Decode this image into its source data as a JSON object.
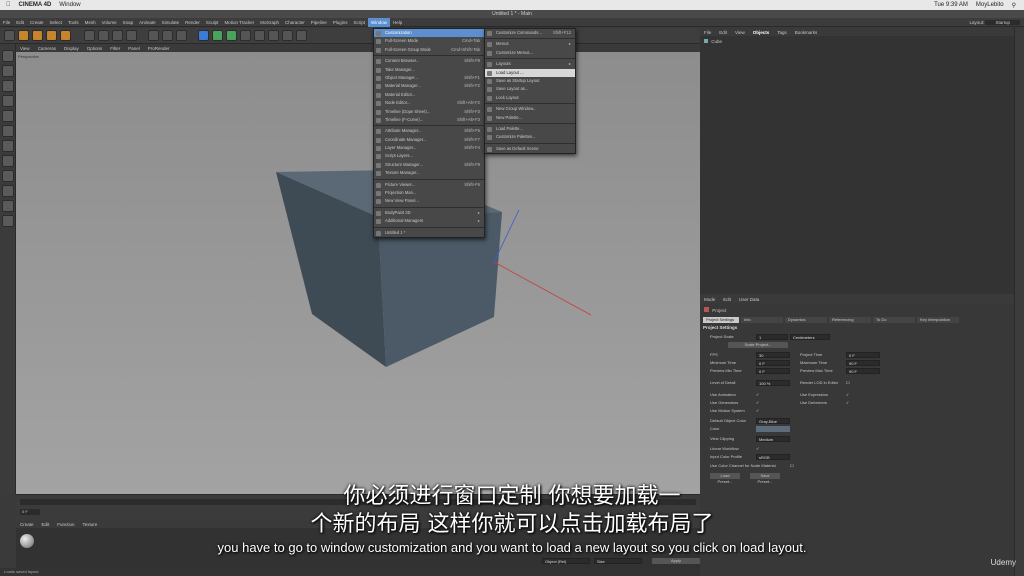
{
  "macbar": {
    "app": "CINEMA 4D",
    "menu": "Window",
    "time": "Tue 9:39 AM",
    "user": "MoyLebito"
  },
  "window_title": "Untitled 1 * - Main",
  "menubar": [
    "File",
    "Edit",
    "Create",
    "Select",
    "Tools",
    "Mesh",
    "Volume",
    "Snap",
    "Animate",
    "Simulate",
    "Render",
    "Sculpt",
    "Motion Tracker",
    "MoGraph",
    "Character",
    "Pipeline",
    "Plugins",
    "Script",
    "Window",
    "Help"
  ],
  "menubar_active": "Window",
  "layout": {
    "label": "Layout:",
    "value": "Startup"
  },
  "viewport_menu": [
    "View",
    "Cameras",
    "Display",
    "Options",
    "Filter",
    "Panel",
    "ProRender"
  ],
  "viewport_label": "Perspective",
  "material_menu": [
    "Create",
    "Edit",
    "Function",
    "Texture"
  ],
  "statusbar": "Loads saved layout",
  "object_menu": [
    "File",
    "Edit",
    "View",
    "Objects",
    "Tags",
    "Bookmarks"
  ],
  "object_menu_active": "Objects",
  "object_item": "Cube",
  "attr_menu": [
    "Mode",
    "Edit",
    "User Data"
  ],
  "attr_header": "Project",
  "attr_tabs": [
    "Project Settings",
    "Info",
    "Dynamics",
    "Referencing",
    "To Do",
    "Key Interpolation"
  ],
  "attr_section": "Project Settings",
  "attrs": {
    "project_scale": "Project Scale",
    "project_scale_val": "1",
    "project_scale_unit": "Centimeters",
    "scale_project": "Scale Project...",
    "fps": "FPS",
    "fps_val": "30",
    "project_time": "Project Time",
    "project_time_val": "0 F",
    "min_time": "Minimum Time",
    "min_time_val": "0 F",
    "max_time": "Maximum Time",
    "max_time_val": "90 F",
    "prev_min": "Preview Min Time",
    "prev_min_val": "0 F",
    "prev_max": "Preview Max Time",
    "prev_max_val": "90 F",
    "lod": "Level of Detail",
    "lod_val": "100 %",
    "render_lod": "Render LOD in Editor",
    "use_anim": "Use Animation",
    "use_expr": "Use Expression",
    "use_gen": "Use Generators",
    "use_def": "Use Deformers",
    "use_motion": "Use Motion System",
    "def_obj_color": "Default Object Color",
    "def_obj_color_val": "Gray-Blue",
    "color": "Color",
    "view_clipping": "View Clipping",
    "view_clipping_val": "Medium",
    "linear_wf": "Linear Workflow",
    "input_color": "Input Color Profile",
    "input_color_val": "sRGB",
    "use_color_channel": "Use Color Channel for Node Material",
    "load_preset": "Load Preset...",
    "save_preset": "Save Preset..."
  },
  "bottom_fields": {
    "object_rel": "Object (Rel)",
    "size": "Size",
    "apply": "Apply"
  },
  "window_menu": [
    {
      "label": "Customization",
      "shortcut": "",
      "hl": true
    },
    {
      "label": "Full-Screen Mode",
      "shortcut": "Cmd+Tab"
    },
    {
      "label": "Full-Screen Group Mode",
      "shortcut": "Cmd+Shift+Tab"
    },
    {
      "sep": true
    },
    {
      "label": "Content Browser...",
      "shortcut": "Shift+F8"
    },
    {
      "label": "Take Manager...",
      "shortcut": ""
    },
    {
      "label": "Object Manager...",
      "shortcut": "Shift+F1"
    },
    {
      "label": "Material Manager...",
      "shortcut": "Shift+F2"
    },
    {
      "label": "Material Editor...",
      "shortcut": ""
    },
    {
      "label": "Node Editor...",
      "shortcut": "Shift+Alt+F2"
    },
    {
      "label": "Timeline (Dope Sheet)...",
      "shortcut": "Shift+F3"
    },
    {
      "label": "Timeline (F-Curve)...",
      "shortcut": "Shift+Alt+F3"
    },
    {
      "sep": true
    },
    {
      "label": "Attribute Manager...",
      "shortcut": "Shift+F5"
    },
    {
      "label": "Coordinate Manager...",
      "shortcut": "Shift+F7"
    },
    {
      "label": "Layer Manager...",
      "shortcut": "Shift+F4"
    },
    {
      "label": "Script Layers...",
      "shortcut": ""
    },
    {
      "label": "Structure Manager...",
      "shortcut": "Shift+F9"
    },
    {
      "label": "Texture Manager...",
      "shortcut": ""
    },
    {
      "sep": true
    },
    {
      "label": "Picture Viewer...",
      "shortcut": "Shift+F6"
    },
    {
      "label": "Projection Man...",
      "shortcut": ""
    },
    {
      "label": "New View Panel...",
      "shortcut": ""
    },
    {
      "sep": true
    },
    {
      "label": "BodyPaint 3D",
      "shortcut": "▸"
    },
    {
      "label": "Additional Managers",
      "shortcut": "▸"
    },
    {
      "sep": true
    },
    {
      "label": "Untitled 1 *",
      "shortcut": ""
    }
  ],
  "custom_menu": [
    {
      "label": "Customize Commands...",
      "shortcut": "Shift+F12"
    },
    {
      "sep": true
    },
    {
      "label": "Menus",
      "shortcut": "▸"
    },
    {
      "label": "Customize Menus...",
      "shortcut": ""
    },
    {
      "sep": true
    },
    {
      "label": "Layouts",
      "shortcut": "▸"
    },
    {
      "label": "Load Layout ...",
      "shortcut": "",
      "hover": true
    },
    {
      "label": "Save as Startup Layout",
      "shortcut": ""
    },
    {
      "label": "Save Layout as...",
      "shortcut": ""
    },
    {
      "label": "Lock Layout",
      "shortcut": ""
    },
    {
      "sep": true
    },
    {
      "label": "New Group Window...",
      "shortcut": ""
    },
    {
      "label": "New Palette...",
      "shortcut": ""
    },
    {
      "sep": true
    },
    {
      "label": "Load Palette...",
      "shortcut": ""
    },
    {
      "label": "Customize Palettes...",
      "shortcut": ""
    },
    {
      "sep": true
    },
    {
      "label": "Save as Default Scene",
      "shortcut": ""
    }
  ],
  "subtitles": {
    "cn1": "你必须进行窗口定制 你想要加载一",
    "cn2": "个新的布局 这样你就可以点击加载布局了",
    "en": "you have to go to window customization and you want to load a new layout so you click on load layout."
  },
  "watermark": "Udemy",
  "colors": {
    "accent": "#5b8fcf",
    "cube": "#4b5a66"
  }
}
